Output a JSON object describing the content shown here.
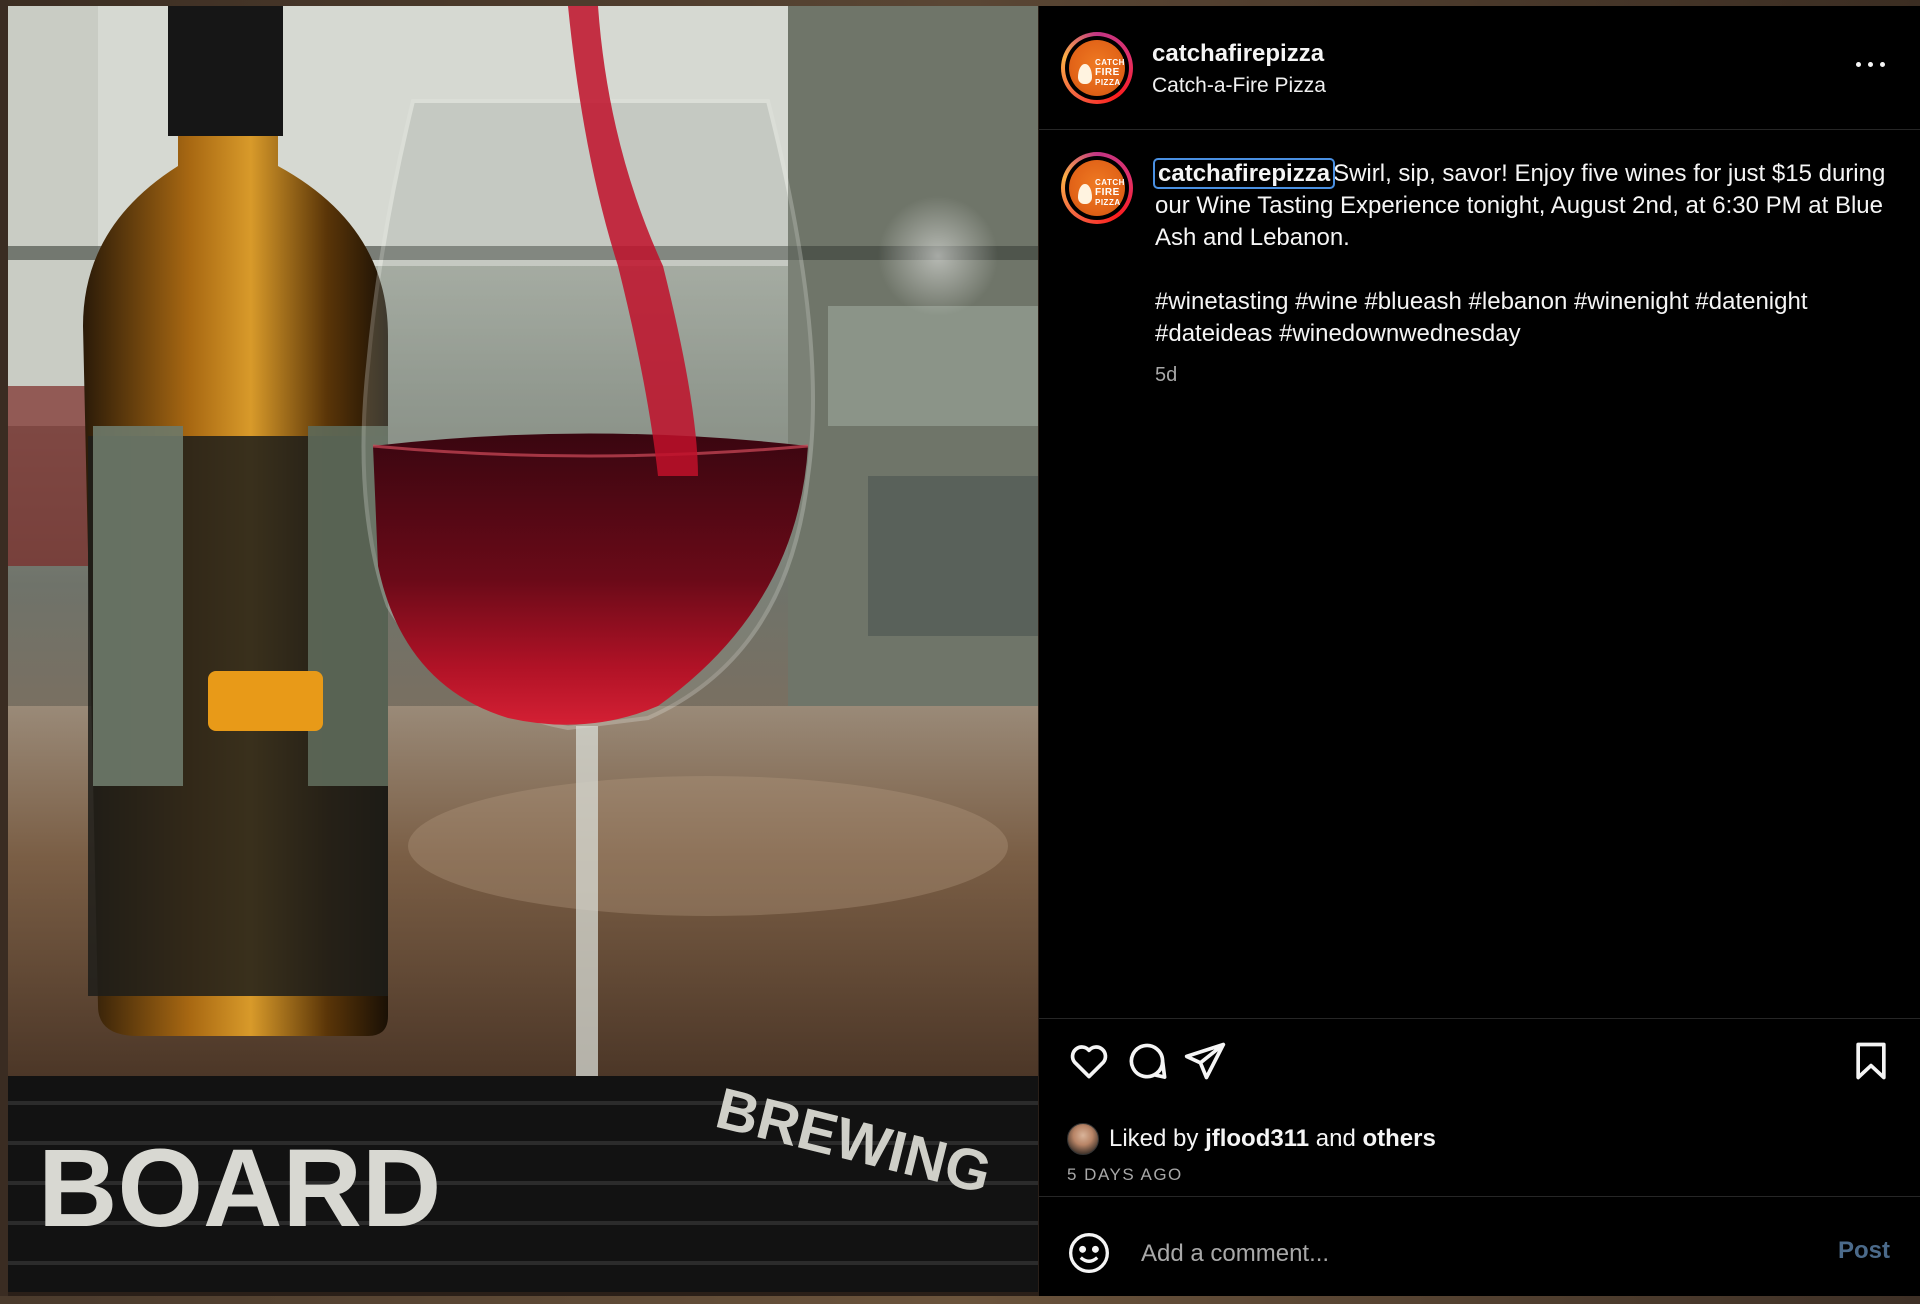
{
  "photo": {
    "alt": "Red wine being poured into a glass next to a wine bottle on a bar mat",
    "mat_text": "BOARD",
    "mat_text_2": "BREWING"
  },
  "header": {
    "username": "catchafirepizza",
    "display_name": "Catch-a-Fire Pizza",
    "logo_line1": "CATCH",
    "logo_line2": "FIRE",
    "logo_line3": "PIZZA",
    "more_icon": "more-horizontal-icon"
  },
  "caption": {
    "username": "catchafirepizza",
    "text": "Swirl, sip, savor! Enjoy five wines for just $15 during our Wine Tasting Experience tonight, August 2nd, at 6:30 PM at Blue Ash and Lebanon.",
    "hashtags": "#winetasting #wine #blueash #lebanon #winenight #datenight #dateideas #winedownwednesday",
    "timestamp": "5d"
  },
  "actions": {
    "like_icon": "heart-icon",
    "comment_icon": "comment-icon",
    "share_icon": "send-icon",
    "save_icon": "bookmark-icon",
    "liked_prefix": "Liked by",
    "liked_user": "jflood311",
    "liked_and": "and",
    "liked_others": "others",
    "posted_ago": "5 DAYS AGO"
  },
  "comment_box": {
    "emoji_icon": "emoji-icon",
    "placeholder": "Add a comment...",
    "value": "",
    "post_label": "Post"
  },
  "colors": {
    "panel_bg": "#000000",
    "text": "#f5f5f5",
    "muted": "#a8a8a8",
    "post_button_disabled": "#4b6a8a",
    "selection_outline": "#4a90e2",
    "brand_orange": "#e26418"
  }
}
